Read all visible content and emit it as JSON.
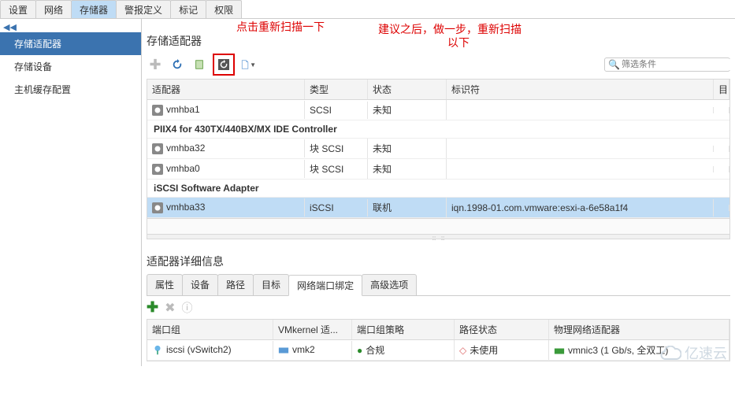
{
  "topTabs": {
    "t0": "设置",
    "t1": "网络",
    "t2": "存储器",
    "t3": "警报定义",
    "t4": "标记",
    "t5": "权限"
  },
  "sidebar": {
    "s0": "存储适配器",
    "s1": "存储设备",
    "s2": "主机缓存配置"
  },
  "annotations": {
    "a1": "点击重新扫描一下",
    "a2": "建议之后，做一步，重新扫描",
    "a2b": "以下"
  },
  "section_adapters": "存储适配器",
  "filter": {
    "placeholder": "筛选条件"
  },
  "grid": {
    "h_adapter": "适配器",
    "h_type": "类型",
    "h_status": "状态",
    "h_id": "标识符",
    "h_last": "目",
    "group1": "PIIX4 for 430TX/440BX/MX IDE Controller",
    "group2": "iSCSI Software Adapter",
    "r0": {
      "name": "vmhba1",
      "type": "SCSI",
      "status": "未知",
      "id": ""
    },
    "r1": {
      "name": "vmhba32",
      "type": "块 SCSI",
      "status": "未知",
      "id": ""
    },
    "r2": {
      "name": "vmhba0",
      "type": "块 SCSI",
      "status": "未知",
      "id": ""
    },
    "r3": {
      "name": "vmhba33",
      "type": "iSCSI",
      "status": "联机",
      "id": "iqn.1998-01.com.vmware:esxi-a-6e58a1f4"
    }
  },
  "section_details": "适配器详细信息",
  "subtabs": {
    "t0": "属性",
    "t1": "设备",
    "t2": "路径",
    "t3": "目标",
    "t4": "网络端口绑定",
    "t5": "高级选项"
  },
  "grid2": {
    "h_pg": "端口组",
    "h_vmk": "VMkernel 适...",
    "h_pol": "端口组策略",
    "h_path": "路径状态",
    "h_phys": "物理网络适配器",
    "row": {
      "pg": "iscsi (vSwitch2)",
      "vmk": "vmk2",
      "pol": "合规",
      "path": "未使用",
      "phys": "vmnic3 (1 Gb/s, 全双工)"
    }
  },
  "brand": "亿速云"
}
